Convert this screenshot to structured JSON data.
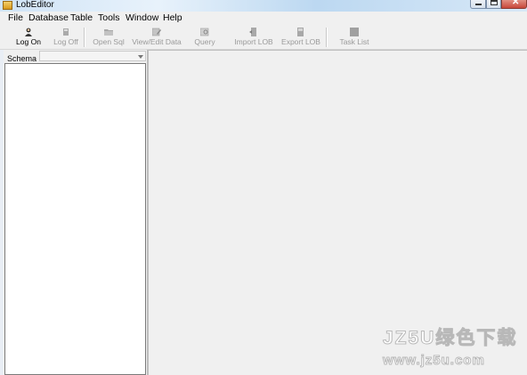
{
  "window": {
    "title": "LobEditor",
    "close_glyph": "✕"
  },
  "menu": [
    {
      "label": "File"
    },
    {
      "label": "Database"
    },
    {
      "label": "Table"
    },
    {
      "label": "Tools"
    },
    {
      "label": "Window"
    },
    {
      "label": "Help"
    }
  ],
  "toolbar": {
    "log_on": "Log On",
    "log_off": "Log Off",
    "open_sql": "Open Sql",
    "view_edit_data": "View/Edit Data",
    "query": "Query",
    "import_lob": "Import LOB",
    "export_lob": "Export LOB",
    "task_list": "Task List"
  },
  "schema": {
    "label": "Schema",
    "value": ""
  },
  "watermark": {
    "line1": "JZ5U绿色下载",
    "line2": "www.jz5u.com"
  },
  "colors": {
    "accent_titlebar": "#cfe3f6",
    "disabled_text": "#9a9a9a"
  }
}
